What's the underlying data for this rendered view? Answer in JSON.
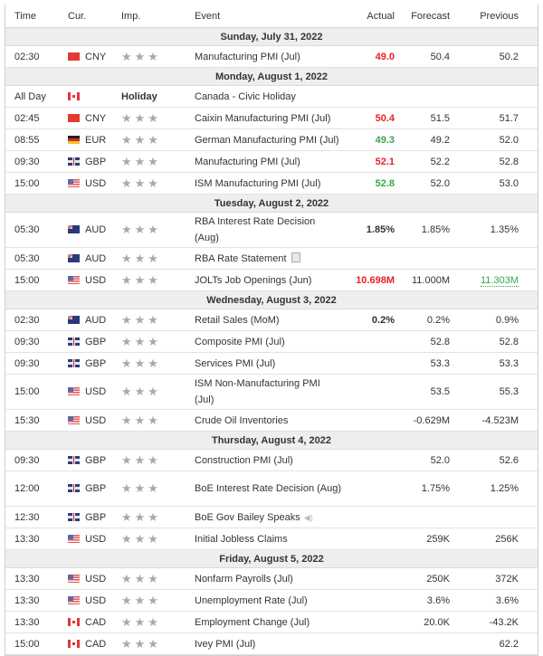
{
  "header": {
    "time": "Time",
    "currency": "Cur.",
    "importance": "Imp.",
    "event": "Event",
    "actual": "Actual",
    "forecast": "Forecast",
    "previous": "Previous"
  },
  "colors": {
    "worse": "#ec1e24",
    "better": "#3aa64a",
    "group_bg": "#eeeeee",
    "star": "#a9a9a9"
  },
  "importance_icon": "star-icon",
  "days": [
    {
      "label": "Sunday, July 31, 2022",
      "rows": [
        {
          "time": "02:30",
          "flag": "china",
          "currency": "CNY",
          "stars": "★★★",
          "event": "Manufacturing PMI (Jul)",
          "actual": "49.0",
          "actual_status": "red",
          "forecast": "50.4",
          "previous": "50.2"
        }
      ]
    },
    {
      "label": "Monday, August 1, 2022",
      "rows": [
        {
          "time": "All Day",
          "flag": "canada",
          "currency": "",
          "importance_text": "Holiday",
          "event": "Canada - Civic Holiday",
          "actual": "",
          "forecast": "",
          "previous": ""
        },
        {
          "time": "02:45",
          "flag": "china",
          "currency": "CNY",
          "stars": "★★★",
          "event": "Caixin Manufacturing PMI (Jul)",
          "actual": "50.4",
          "actual_status": "red",
          "forecast": "51.5",
          "previous": "51.7"
        },
        {
          "time": "08:55",
          "flag": "germany",
          "currency": "EUR",
          "stars": "★★★",
          "event": "German Manufacturing PMI (Jul)",
          "actual": "49.3",
          "actual_status": "green",
          "forecast": "49.2",
          "previous": "52.0"
        },
        {
          "time": "09:30",
          "flag": "uk",
          "currency": "GBP",
          "stars": "★★★",
          "event": "Manufacturing PMI (Jul)",
          "actual": "52.1",
          "actual_status": "red",
          "forecast": "52.2",
          "previous": "52.8"
        },
        {
          "time": "15:00",
          "flag": "usa",
          "currency": "USD",
          "stars": "★★★",
          "event": "ISM Manufacturing PMI (Jul)",
          "actual": "52.8",
          "actual_status": "green",
          "forecast": "52.0",
          "previous": "53.0"
        }
      ]
    },
    {
      "label": "Tuesday, August 2, 2022",
      "rows": [
        {
          "time": "05:30",
          "flag": "australia",
          "currency": "AUD",
          "stars": "★★★",
          "event": "RBA Interest Rate Decision (Aug)",
          "actual": "1.85%",
          "actual_status": "neutral",
          "forecast": "1.85%",
          "previous": "1.35%"
        },
        {
          "time": "05:30",
          "flag": "australia",
          "currency": "AUD",
          "stars": "★★★",
          "event": "RBA Rate Statement",
          "event_icon": "document-icon",
          "actual": "",
          "forecast": "",
          "previous": ""
        },
        {
          "time": "15:00",
          "flag": "usa",
          "currency": "USD",
          "stars": "★★★",
          "event": "JOLTs Job Openings (Jun)",
          "actual": "10.698M",
          "actual_status": "red",
          "forecast": "11.000M",
          "previous": "11.303M",
          "previous_status": "revised-up"
        }
      ]
    },
    {
      "label": "Wednesday, August 3, 2022",
      "rows": [
        {
          "time": "02:30",
          "flag": "australia",
          "currency": "AUD",
          "stars": "★★★",
          "event": "Retail Sales (MoM)",
          "actual": "0.2%",
          "actual_status": "neutral",
          "forecast": "0.2%",
          "previous": "0.9%"
        },
        {
          "time": "09:30",
          "flag": "uk",
          "currency": "GBP",
          "stars": "★★★",
          "event": "Composite PMI (Jul)",
          "actual": "",
          "forecast": "52.8",
          "previous": "52.8"
        },
        {
          "time": "09:30",
          "flag": "uk",
          "currency": "GBP",
          "stars": "★★★",
          "event": "Services PMI (Jul)",
          "actual": "",
          "forecast": "53.3",
          "previous": "53.3"
        },
        {
          "time": "15:00",
          "flag": "usa",
          "currency": "USD",
          "stars": "★★★",
          "event": "ISM Non-Manufacturing PMI (Jul)",
          "actual": "",
          "forecast": "53.5",
          "previous": "55.3"
        },
        {
          "time": "15:30",
          "flag": "usa",
          "currency": "USD",
          "stars": "★★★",
          "event": "Crude Oil Inventories",
          "actual": "",
          "forecast": "-0.629M",
          "previous": "-4.523M"
        }
      ]
    },
    {
      "label": "Thursday, August 4, 2022",
      "rows": [
        {
          "time": "09:30",
          "flag": "uk",
          "currency": "GBP",
          "stars": "★★★",
          "event": "Construction PMI (Jul)",
          "actual": "",
          "forecast": "52.0",
          "previous": "52.6"
        },
        {
          "time": "12:00",
          "flag": "uk",
          "currency": "GBP",
          "stars": "★★★",
          "event": "BoE Interest Rate Decision (Aug)",
          "actual": "",
          "forecast": "1.75%",
          "previous": "1.25%"
        },
        {
          "time": "12:30",
          "flag": "uk",
          "currency": "GBP",
          "stars": "★★★",
          "event": "BoE Gov Bailey Speaks",
          "event_icon": "speaker-icon",
          "actual": "",
          "forecast": "",
          "previous": ""
        },
        {
          "time": "13:30",
          "flag": "usa",
          "currency": "USD",
          "stars": "★★★",
          "event": "Initial Jobless Claims",
          "actual": "",
          "forecast": "259K",
          "previous": "256K"
        }
      ]
    },
    {
      "label": "Friday, August 5, 2022",
      "rows": [
        {
          "time": "13:30",
          "flag": "usa",
          "currency": "USD",
          "stars": "★★★",
          "event": "Nonfarm Payrolls (Jul)",
          "actual": "",
          "forecast": "250K",
          "previous": "372K"
        },
        {
          "time": "13:30",
          "flag": "usa",
          "currency": "USD",
          "stars": "★★★",
          "event": "Unemployment Rate (Jul)",
          "actual": "",
          "forecast": "3.6%",
          "previous": "3.6%"
        },
        {
          "time": "13:30",
          "flag": "canada",
          "currency": "CAD",
          "stars": "★★★",
          "event": "Employment Change (Jul)",
          "actual": "",
          "forecast": "20.0K",
          "previous": "-43.2K"
        },
        {
          "time": "15:00",
          "flag": "canada",
          "currency": "CAD",
          "stars": "★★★",
          "event": "Ivey PMI (Jul)",
          "actual": "",
          "forecast": "",
          "previous": "62.2"
        }
      ]
    }
  ]
}
